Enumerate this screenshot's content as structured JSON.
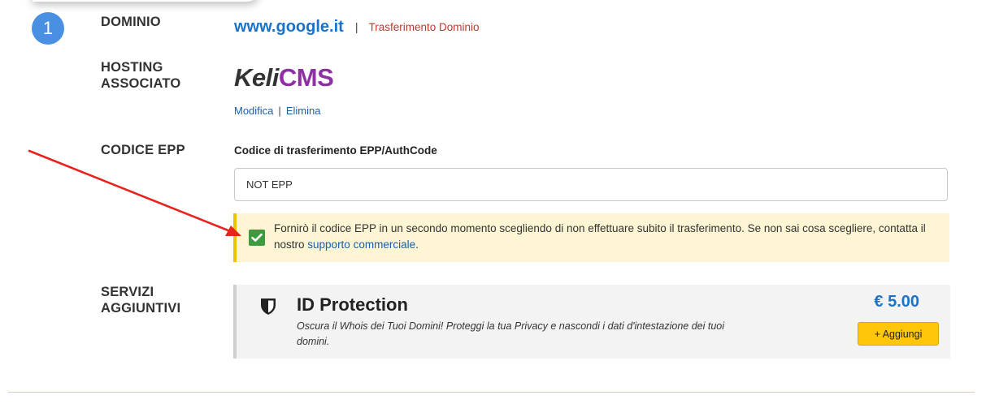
{
  "step": {
    "number": "1"
  },
  "domain": {
    "label": "DOMINIO",
    "name": "www.google.it",
    "separator": "|",
    "action": "Trasferimento Dominio"
  },
  "hosting": {
    "label_line1": "HOSTING",
    "label_line2": "ASSOCIATO",
    "logo_part1": "Keli",
    "logo_part2": "CMS",
    "edit_link": "Modifica",
    "separator": "|",
    "delete_link": "Elimina"
  },
  "epp": {
    "label": "CODICE EPP",
    "field_title": "Codice di trasferimento EPP/AuthCode",
    "value": "NOT EPP",
    "notice_text": "Fornirò il codice EPP in un secondo momento scegliendo di non effettuare subito il trasferimento. Se non sai cosa scegliere, contatta il nostro ",
    "notice_link": "supporto commerciale",
    "notice_end": ".",
    "checked": true
  },
  "services": {
    "label_line1": "SERVIZI",
    "label_line2": "AGGIUNTIVI",
    "items": [
      {
        "icon": "shield-icon",
        "title": "ID Protection",
        "description": "Oscura il Whois dei Tuoi Domini! Proteggi la tua Privacy e nascondi i dati d'intestazione dei tuoi domini.",
        "price": "€ 5.00",
        "button_label": "+ Aggiungi"
      }
    ]
  },
  "colors": {
    "badge": "#4a90e2",
    "domain_link": "#1a73c8",
    "action": "#c0392b",
    "logo_accent": "#8e2fa3",
    "notice_bg": "#fdf5d3",
    "notice_border": "#f2c200",
    "check": "#3e9a3e",
    "button": "#ffc60a",
    "annotation_arrow": "#e8231f"
  }
}
